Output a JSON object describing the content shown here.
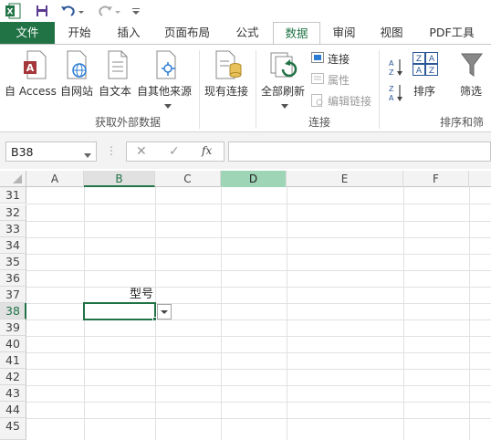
{
  "accent": "#217346",
  "qat": {
    "excel_icon": "excel-logo-icon",
    "save_icon": "save-icon",
    "undo_icon": "undo-icon",
    "redo_icon": "redo-icon",
    "customize_icon": "customize-qat-icon"
  },
  "tabs": {
    "file": "文件",
    "home": "开始",
    "insert": "插入",
    "page_layout": "页面布局",
    "formulas": "公式",
    "data": "数据",
    "review": "审阅",
    "view": "视图",
    "pdf": "PDF工具"
  },
  "ribbon": {
    "from_access": "自 Access",
    "from_web": "自网站",
    "from_text": "自文本",
    "from_other": "自其他来源",
    "existing": "现有连接",
    "refresh_all": "全部刷新",
    "connections": "连接",
    "properties": "属性",
    "edit_links": "编辑链接",
    "sort": "排序",
    "filter": "筛选",
    "group_external": "获取外部数据",
    "group_connections": "连接",
    "group_sort": "排序和筛"
  },
  "formula_bar": {
    "name_box": "B38",
    "formula": "",
    "fx": "fx"
  },
  "grid": {
    "columns": [
      "A",
      "B",
      "C",
      "D",
      "E",
      "F"
    ],
    "rows": [
      "31",
      "32",
      "33",
      "34",
      "35",
      "36",
      "37",
      "38",
      "39",
      "40",
      "41",
      "42",
      "43",
      "44",
      "45"
    ],
    "selected_row": "38",
    "cell_b37": "型号"
  }
}
